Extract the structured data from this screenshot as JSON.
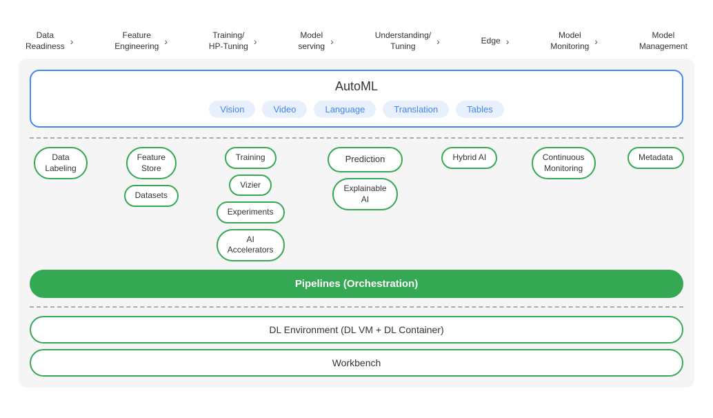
{
  "pipeline_steps": [
    {
      "label": "Data\nReadiness",
      "has_arrow": true
    },
    {
      "label": "Feature\nEngineering",
      "has_arrow": true
    },
    {
      "label": "Training/\nHP-Tuning",
      "has_arrow": true
    },
    {
      "label": "Model\nserving",
      "has_arrow": true
    },
    {
      "label": "Understanding/\nTuning",
      "has_arrow": true
    },
    {
      "label": "Edge",
      "has_arrow": true
    },
    {
      "label": "Model\nMonitoring",
      "has_arrow": true
    },
    {
      "label": "Model\nManagement",
      "has_arrow": false
    }
  ],
  "automl": {
    "title": "AutoML",
    "pills": [
      "Vision",
      "Video",
      "Language",
      "Translation",
      "Tables"
    ]
  },
  "components": {
    "col1": [
      "Data\nLabeling"
    ],
    "col2": [
      "Feature\nStore",
      "Datasets"
    ],
    "col3": [
      "Training",
      "Vizier",
      "Experiments",
      "AI\nAccelerators"
    ],
    "col4": [
      "Prediction",
      "Explainable\nAI"
    ],
    "col5": [
      "Hybrid AI"
    ],
    "col6": [
      "Continuous\nMonitoring"
    ],
    "col7": [
      "Metadata"
    ]
  },
  "pipelines_label": "Pipelines (Orchestration)",
  "bottom": {
    "dl_env": "DL Environment (DL VM + DL Container)",
    "workbench": "Workbench"
  },
  "colors": {
    "green": "#34a853",
    "blue": "#4285f4",
    "light_blue_bg": "#e8f0fe",
    "box_bg": "#f5f5f5"
  }
}
